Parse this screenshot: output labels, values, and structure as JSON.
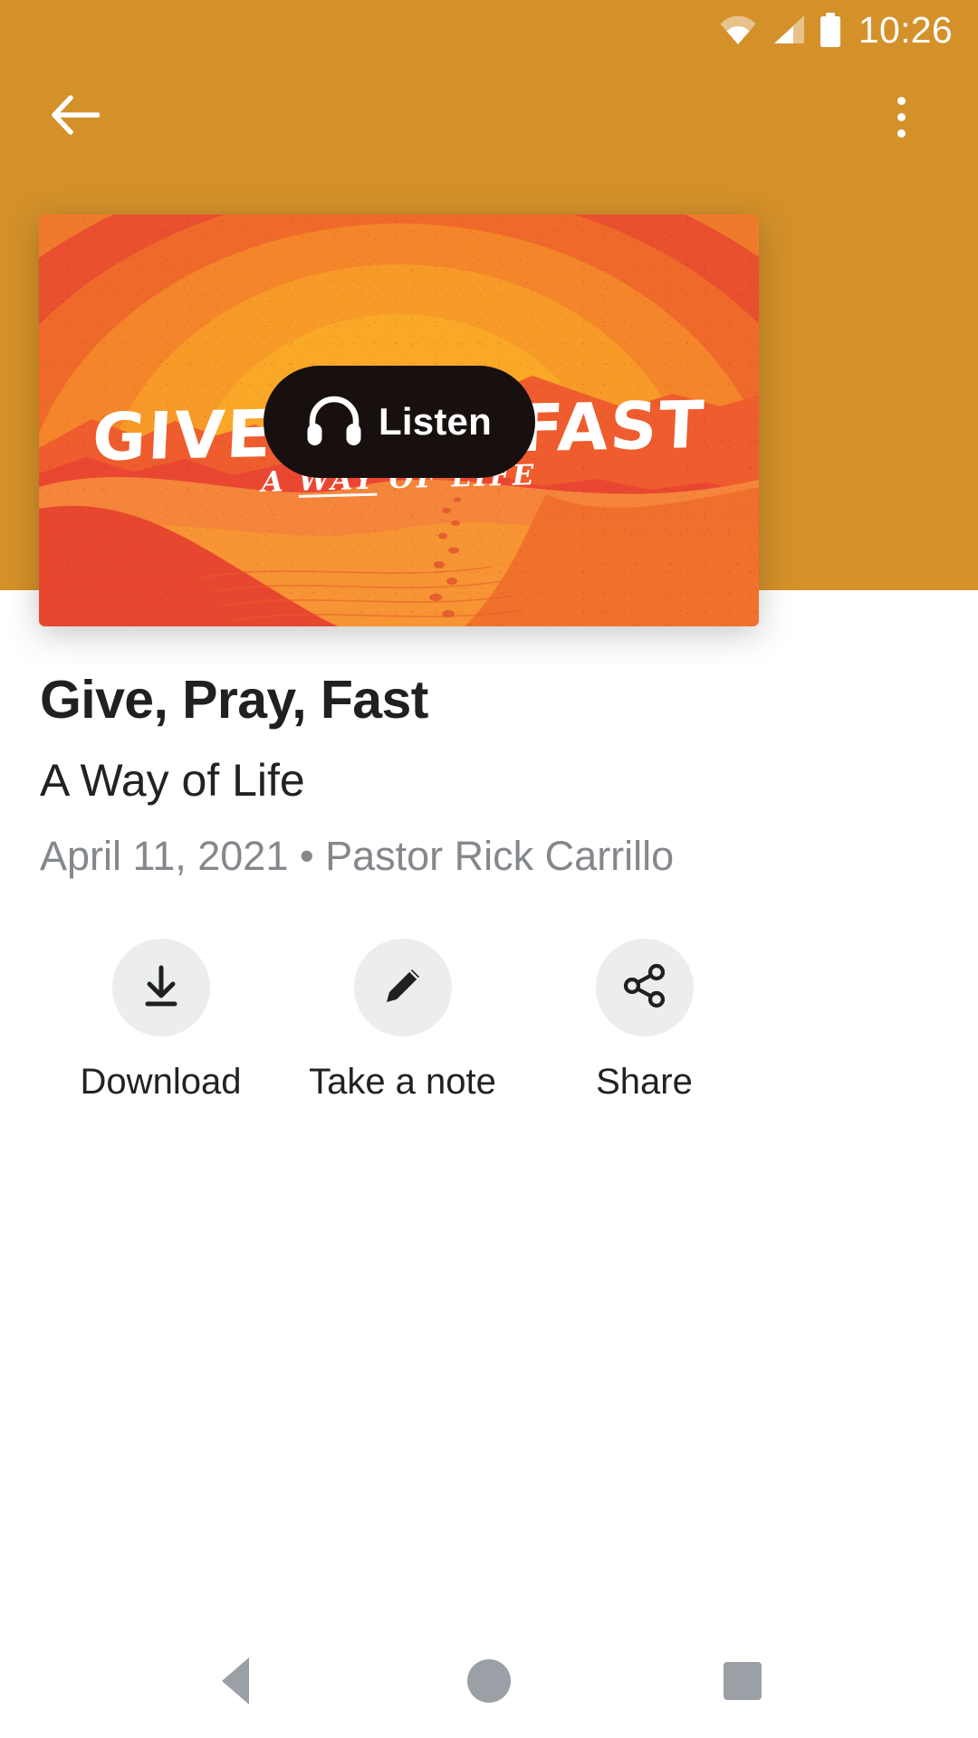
{
  "status_bar": {
    "time": "10:26",
    "icons": [
      "wifi-icon",
      "cell-signal-icon",
      "battery-icon"
    ]
  },
  "app_bar": {
    "back_icon": "back-arrow-icon",
    "overflow_icon": "overflow-menu-icon"
  },
  "hero": {
    "artwork_title": "GIVE PRAY FAST",
    "artwork_subtitle_pre": "A ",
    "artwork_subtitle_underlined": "WAY",
    "artwork_subtitle_post": " OF LIFE",
    "listen_button_label": "Listen",
    "listen_icon": "headphones-icon"
  },
  "details": {
    "title": "Give, Pray, Fast",
    "subtitle": "A Way of Life",
    "meta": "April 11, 2021 • Pastor Rick Carrillo"
  },
  "actions": [
    {
      "label": "Download",
      "icon": "download-icon"
    },
    {
      "label": "Take a note",
      "icon": "pencil-icon"
    },
    {
      "label": "Share",
      "icon": "share-icon"
    }
  ],
  "nav_bar": {
    "back_label": "Back",
    "home_label": "Home",
    "recents_label": "Recents"
  },
  "colors": {
    "header_amber": "#d4912a",
    "art_red": "#e8502f",
    "art_orange": "#f4852a",
    "art_yellow": "#f9a827",
    "pill_dark": "#17100e",
    "text_primary": "#212225",
    "text_muted": "#84888c",
    "action_circle": "#ebedee",
    "nav_gray": "#9aa0a6"
  }
}
